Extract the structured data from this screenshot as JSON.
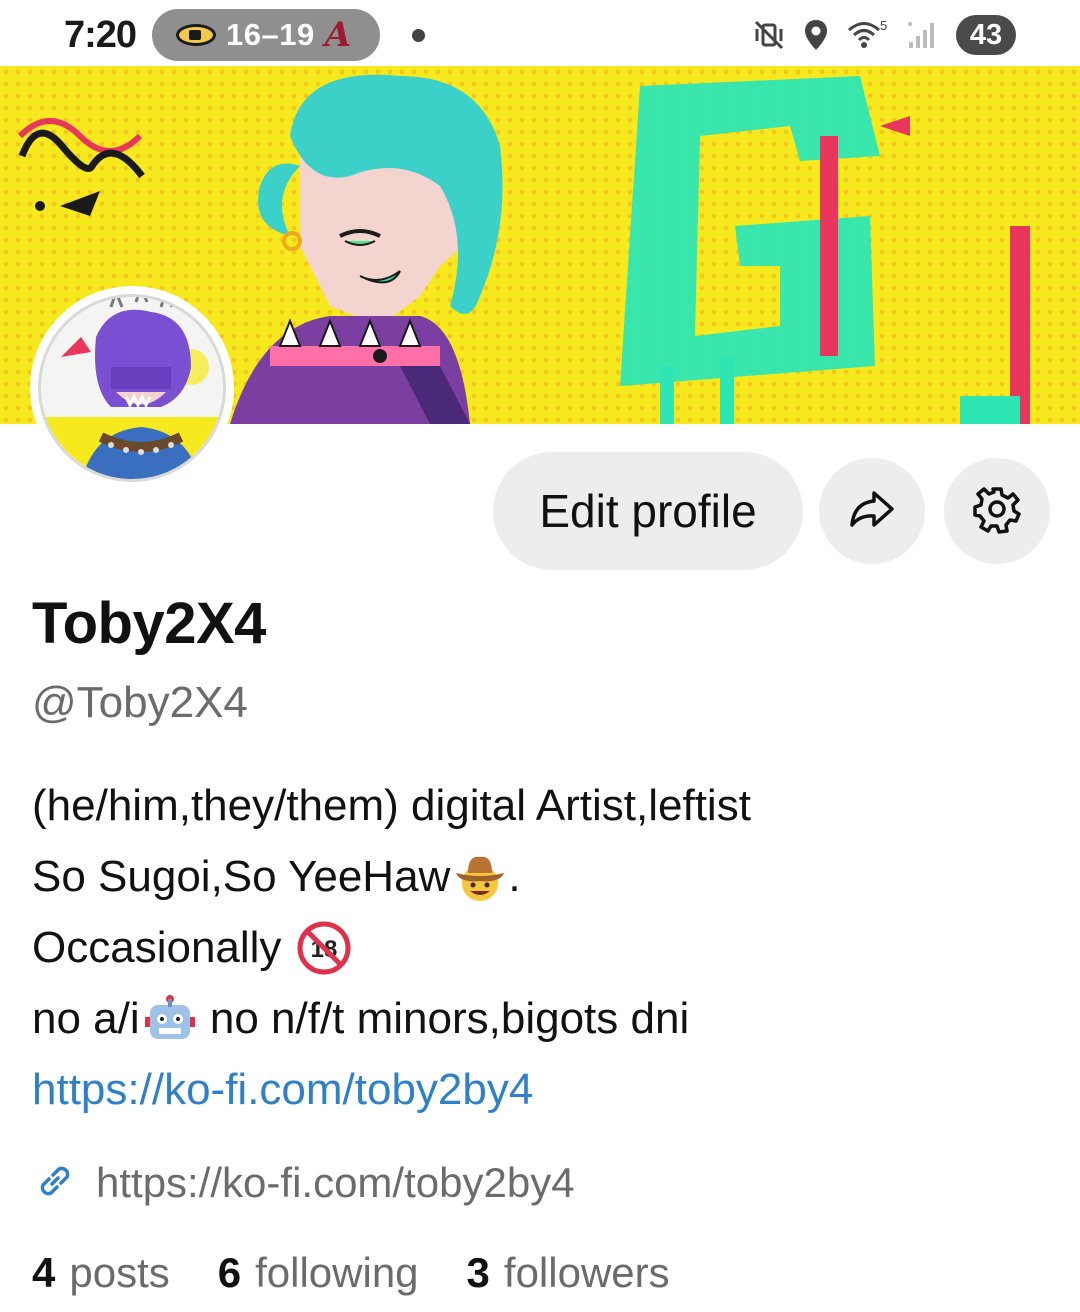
{
  "status_bar": {
    "time": "7:20",
    "score": "16–19",
    "team_2_letter": "A",
    "network_label": "5",
    "battery": "43",
    "icons": [
      "mute-vibrate-icon",
      "location-icon",
      "wifi-icon",
      "signal-icon"
    ]
  },
  "profile": {
    "display_name": "Toby2X4",
    "handle": "@Toby2X4",
    "bio": {
      "line1": "(he/him,they/them) digital Artist,leftist",
      "line2_text": "So Sugoi,So YeeHaw",
      "line2_suffix": ".",
      "line3_text": "Occasionally ",
      "line4_text_a": "no a/i",
      "line4_text_b": " no n/f/t minors,bigots dni",
      "link": "https://ko-fi.com/toby2by4"
    },
    "website": "https://ko-fi.com/toby2by4"
  },
  "actions": {
    "edit_label": "Edit profile",
    "share_icon": "share-icon",
    "settings_icon": "gear-icon"
  },
  "stats": {
    "posts_count": "4",
    "posts_label": "posts",
    "following_count": "6",
    "following_label": "following",
    "followers_count": "3",
    "followers_label": "followers"
  },
  "colors": {
    "banner_yellow": "#f6ea1e",
    "link_blue": "#2f80c8",
    "button_gray": "#ededed",
    "secondary_text": "#6b6b6b"
  }
}
